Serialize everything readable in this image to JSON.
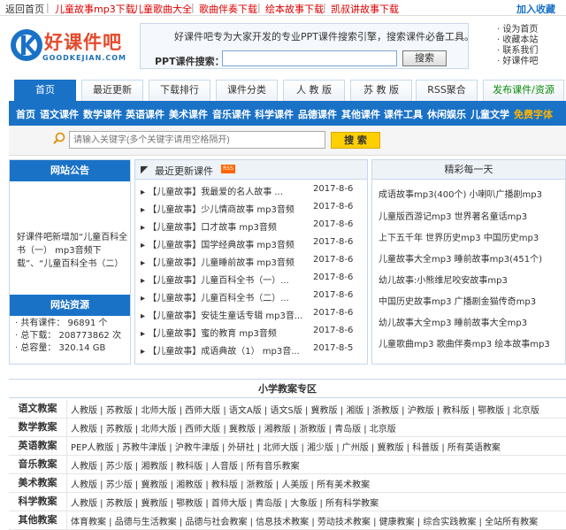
{
  "topbar": {
    "back_home": "返回首页",
    "links": [
      "儿童故事mp3下载",
      "儿童歌曲大全",
      "歌曲伴奏下载",
      "绘本故事下载",
      "凯叔讲故事下载"
    ],
    "favorite": "加入收藏"
  },
  "logo": {
    "name": "好课件吧",
    "domain": "GOODKEJIAN.COM"
  },
  "search": {
    "description": "好课件吧专为大家开发的专业PPT课件搜索引擎，搜索课件必备工具。",
    "label": "PPT课件搜索：",
    "button": "搜索"
  },
  "toplinks": [
    "设为首页",
    "收藏本站",
    "联系我们",
    "好课件吧"
  ],
  "tabs": [
    "首页",
    "最近更新",
    "下载排行",
    "课件分类",
    "人 教 版",
    "苏 教 版",
    "RSS聚合",
    "发布课件/资源"
  ],
  "catnav": [
    "首页",
    "语文课件",
    "数学课件",
    "英语课件",
    "美术课件",
    "音乐课件",
    "科学课件",
    "品德课件",
    "其他课件",
    "课件工具",
    "休闲娱乐",
    "儿童文学",
    "免费字体"
  ],
  "search2": {
    "placeholder": "请输入关键字(多个关键字请用空格隔开)",
    "button": "搜 索"
  },
  "notice": {
    "title": "网站公告",
    "text": "好课件吧新增加“儿童百科全书（一） mp3音频下载”、“儿童百科全书（二）"
  },
  "resources": {
    "title": "网站资源",
    "items": [
      "· 共有课件：  96891 个",
      "· 总下载：  208773862 次",
      "· 总容量：  320.14 GB"
    ]
  },
  "latest": {
    "title": "最近更新课件",
    "rss": "RSS",
    "items": [
      {
        "title": "【儿童故事】我最爱的名人故事 ...",
        "date": "2017-8-6"
      },
      {
        "title": "【儿童故事】少儿情商故事 mp3音频",
        "date": "2017-8-6"
      },
      {
        "title": "【儿童故事】口才故事 mp3音频",
        "date": "2017-8-6"
      },
      {
        "title": "【儿童故事】国学经典故事 mp3音频",
        "date": "2017-8-6"
      },
      {
        "title": "【儿童故事】儿童睡前故事 mp3音频",
        "date": "2017-8-6"
      },
      {
        "title": "【儿童故事】儿童百科全书（一）...",
        "date": "2017-8-6"
      },
      {
        "title": "【儿童故事】儿童百科全书（二）...",
        "date": "2017-8-6"
      },
      {
        "title": "【儿童故事】安徒生童话专辑 mp3音...",
        "date": "2017-8-6"
      },
      {
        "title": "【儿童故事】蜜的教育 mp3音频",
        "date": "2017-8-6"
      },
      {
        "title": "【儿童故事】成语典故（1） mp3音...",
        "date": "2017-8-5"
      }
    ]
  },
  "daily": {
    "title": "精彩每一天",
    "items": [
      "成语故事mp3(400个)  小喇叭广播剧mp3",
      "儿童版西游记mp3  世界著名童话mp3",
      "上下五千年  世界历史mp3  中国历史mp3",
      "儿童故事大全mp3  睡前故事mp3(451个)",
      "幼儿故事:小熊维尼咬安故事mp3",
      "中国历史故事mp3  广播剧金猫传奇mp3",
      "幼儿故事大全mp3  睡前故事大全mp3",
      "儿童歌曲mp3  歌曲伴奏mp3  绘本故事mp3"
    ]
  },
  "primary": {
    "title": "小学教案专区",
    "rows": [
      {
        "label": "语文教案",
        "items": "人教版 | 苏教版 | 北师大版 | 西师大版 | 语文A版 | 语文S版 | 冀教版 | 湘版 | 浙教版 | 沪教版 | 教科版 | 鄂教版 | 北京版"
      },
      {
        "label": "数学教案",
        "items": "人教版 | 苏教版 | 北师大版 | 西师大版 | 冀教版 | 湘教版 | 浙教版 | 青岛版 | 北京版"
      },
      {
        "label": "英语教案",
        "items": "PEP人教版 | 苏教牛津版 | 沪教牛津版 | 外研社 | 北师大版 | 湘少版 | 广州版 | 冀教版 | 科普版 | 所有英语教案"
      },
      {
        "label": "音乐教案",
        "items": "人教版 | 苏少版 | 湘教版 | 教科版 | 人音版 | 所有音乐教案"
      },
      {
        "label": "美术教案",
        "items": "人教版 | 苏少版 | 冀教版 | 湘教版 | 教科版 | 浙教版 | 人美版 | 所有美术教案"
      },
      {
        "label": "科学教案",
        "items": "人教版 | 苏教版 | 冀教版 | 鄂教版 | 首师大版 | 青岛版 | 大象版 | 所有科学教案"
      },
      {
        "label": "其他教案",
        "items": "体育教案 | 品德与生活教案 | 品德与社会教案 | 信息技术教案 | 劳动技术教案 | 健康教案 | 综合实践教案 | 全站所有教案"
      }
    ]
  },
  "colors": {
    "primary_blue": "#1a72c7",
    "accent_red": "#d00",
    "hot_yellow": "#ffd000"
  }
}
